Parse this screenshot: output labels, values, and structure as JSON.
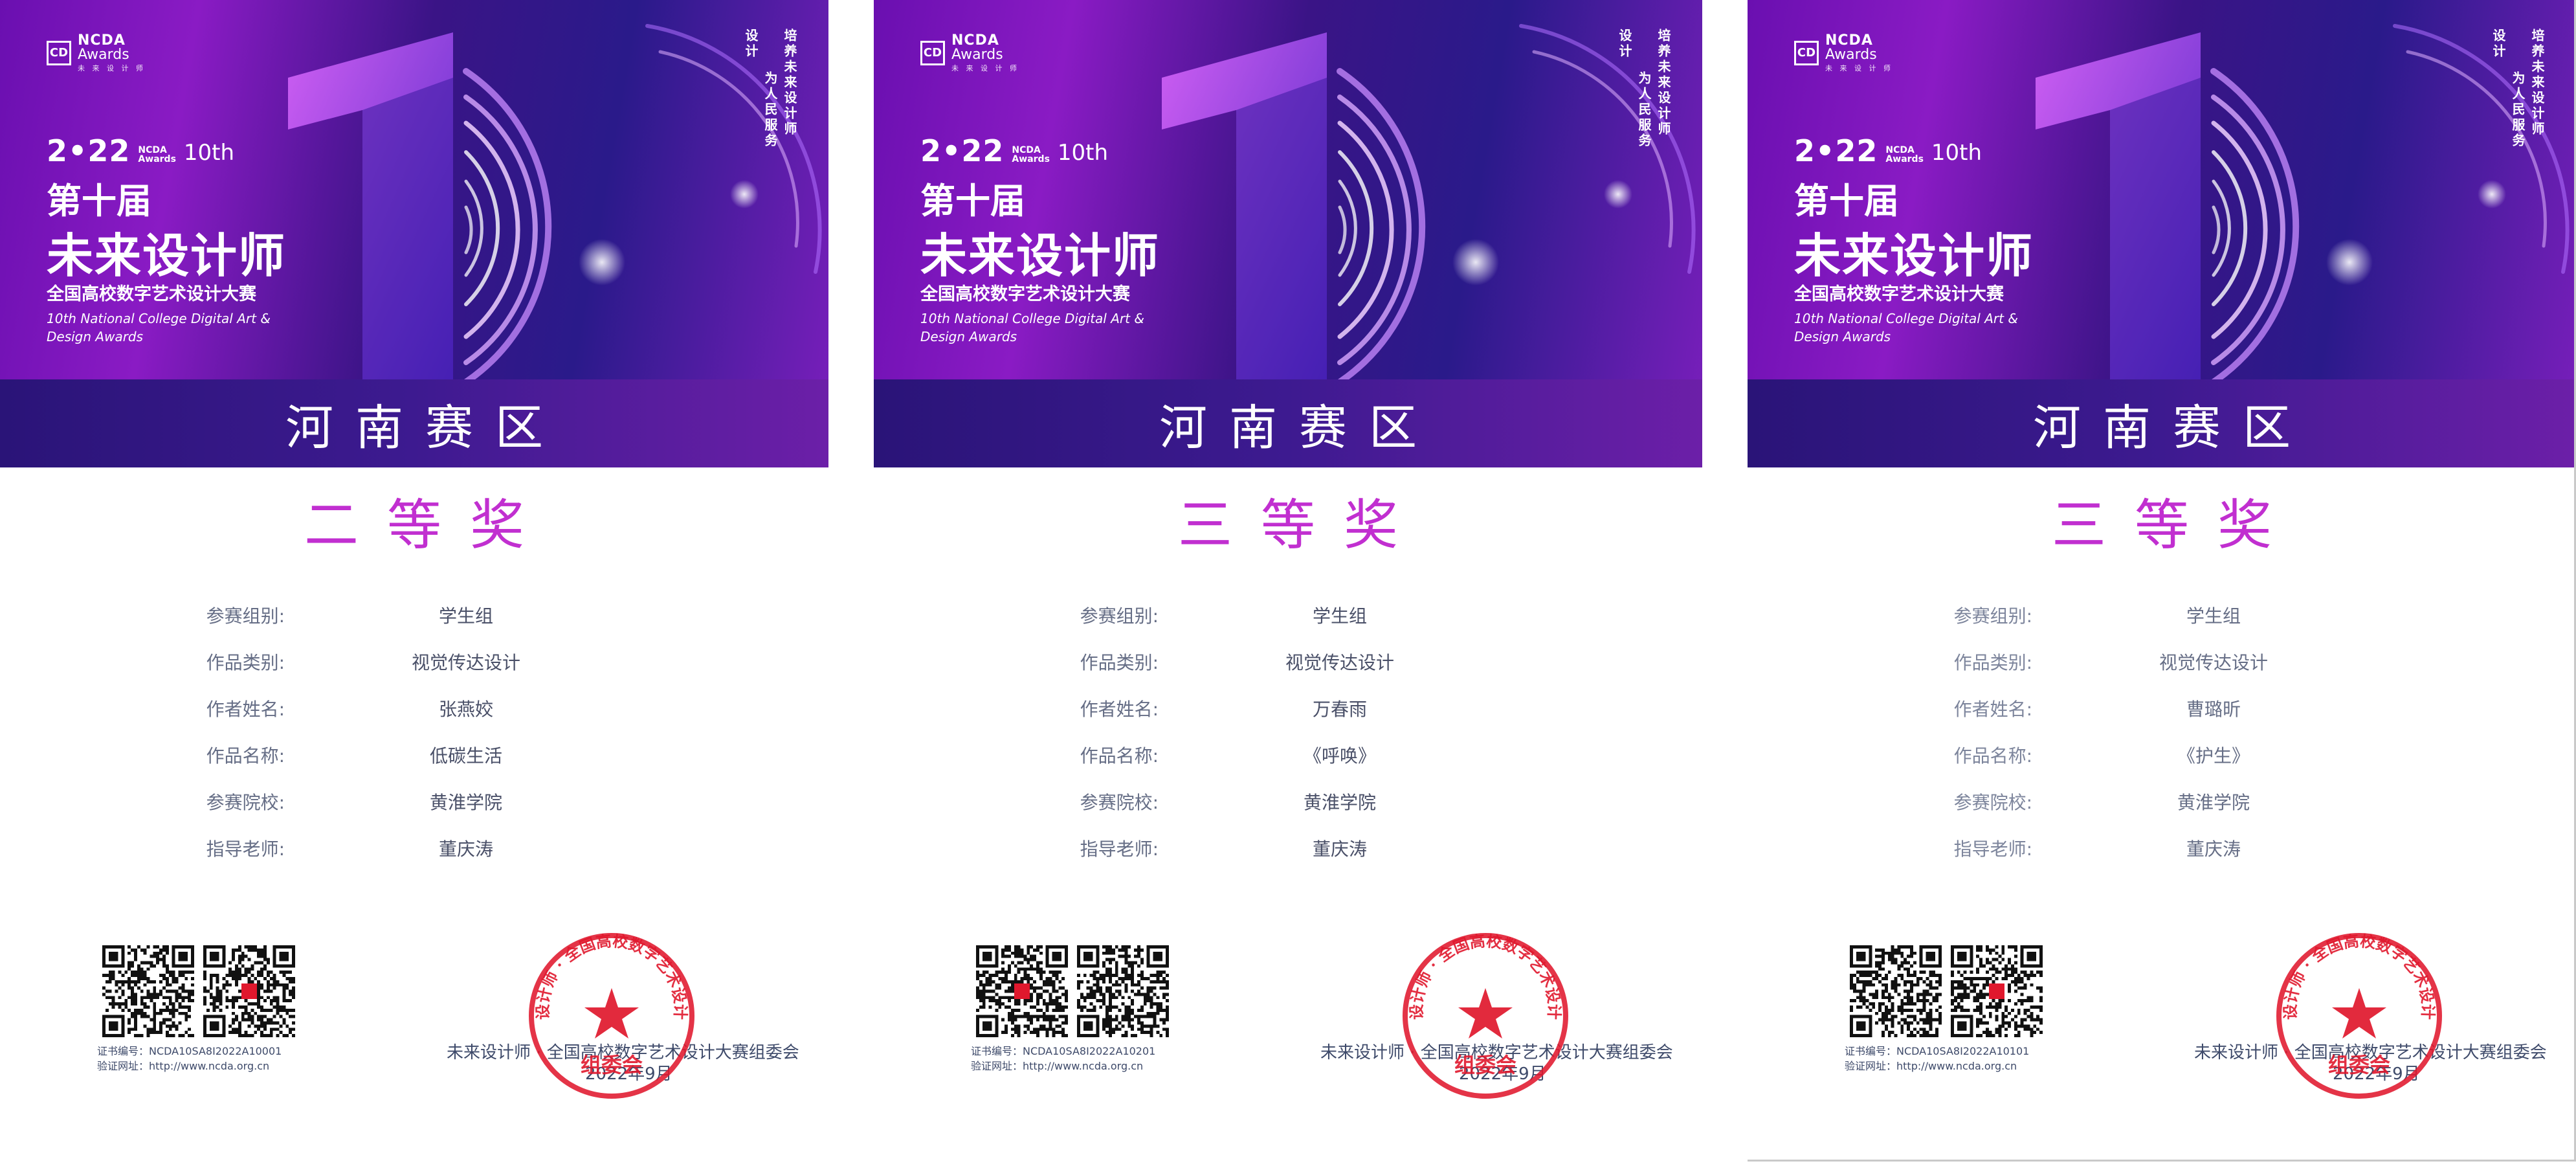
{
  "colors": {
    "award": "#c12fd0",
    "seal": "#e0182d",
    "label": "#666e86",
    "banner_dark": "#2a1478",
    "banner_magenta": "#8a1bc4"
  },
  "banner": {
    "logo_mark": "CD",
    "logo_line1": "NCDA",
    "logo_line2": "Awards",
    "logo_line3": "未 来 设 计 师",
    "edition_year": "2•22",
    "edition_mini_1": "NCDA",
    "edition_mini_2": "Awards",
    "edition_no": "10th",
    "title_small": "第十届",
    "title_big": "未来设计师",
    "title_sub": "全国高校数字艺术设计大赛",
    "title_en": "10th National College Digital Art & Design Awards",
    "slogan_a": "设计",
    "slogan_b": "为人民服务",
    "slogan_c": "培养未来设计师",
    "region": "河南赛区"
  },
  "labels": {
    "group": "参赛组别:",
    "category": "作品类别:",
    "author": "作者姓名:",
    "work": "作品名称:",
    "school": "参赛院校:",
    "teacher": "指导老师:"
  },
  "footer": {
    "committee": "未来设计师 · 全国高校数字艺术设计大赛组委会",
    "date": "2022年9月",
    "seal_text": "未来设计师 · 全国高校数字艺术设计大赛",
    "seal_bottom": "组委会"
  },
  "certificates": [
    {
      "award": "二等奖",
      "group": "学生组",
      "category": "视觉传达设计",
      "author": "张燕姣",
      "work": "低碳生活",
      "school": "黄淮学院",
      "teacher": "董庆涛",
      "cert_no": "证书编号：NCDA10SA8I2022A10001",
      "verify_url": "验证网址：http://www.ncda.org.cn"
    },
    {
      "award": "三等奖",
      "group": "学生组",
      "category": "视觉传达设计",
      "author": "万春雨",
      "work": "《呼唤》",
      "school": "黄淮学院",
      "teacher": "董庆涛",
      "cert_no": "证书编号：NCDA10SA8I2022A10201",
      "verify_url": "验证网址：http://www.ncda.org.cn"
    },
    {
      "award": "三等奖",
      "group": "学生组",
      "category": "视觉传达设计",
      "author": "曹璐昕",
      "work": "《护生》",
      "school": "黄淮学院",
      "teacher": "董庆涛",
      "cert_no": "证书编号：NCDA10SA8I2022A10101",
      "verify_url": "验证网址：http://www.ncda.org.cn"
    }
  ]
}
